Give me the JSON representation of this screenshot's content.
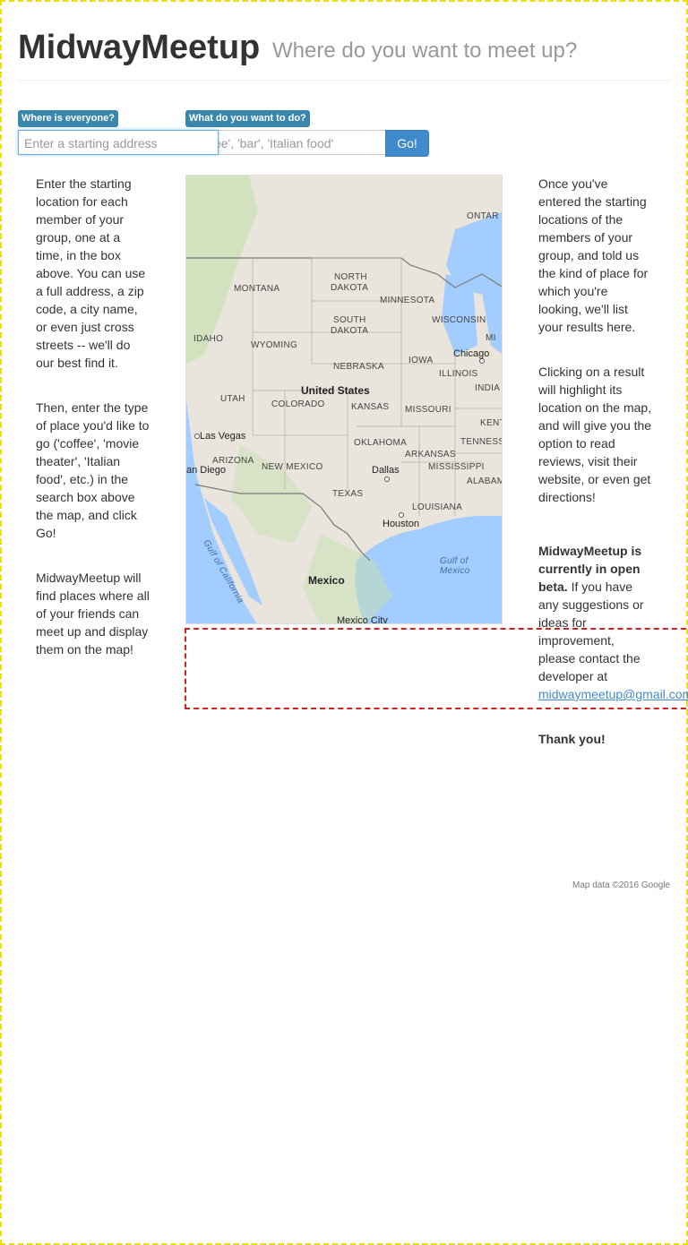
{
  "header": {
    "brand": "MidwayMeetup",
    "tagline": "Where do you want to meet up?"
  },
  "search": {
    "where_label": "Where is everyone?",
    "where_placeholder": "Enter a starting address",
    "what_label": "What do you want to do?",
    "what_placeholder": "'coffee', 'bar', 'Italian food'",
    "go_label": "Go!"
  },
  "instructions_left": [
    "Enter the starting location for each member of your group, one at a time, in the box above. You can use a full address, a zip code, a city name, or even just cross streets -- we'll do our best find it.",
    "Then, enter the type of place you'd like to go ('coffee', 'movie theater', 'Italian food', etc.) in the search box above the map, and click Go!",
    "MidwayMeetup will find places where all of your friends can meet up and display them on the map!"
  ],
  "instructions_right": {
    "p1": "Once you've entered the starting locations of the members of your group, and told us the kind of place for which you're looking, we'll list your results here.",
    "p2": "Clicking on a result will highlight its location on the map, and will give you the option to read reviews, visit their website, or even get directions!",
    "beta_bold": "MidwayMeetup is currently in open beta.",
    "beta_text": " If you have any suggestions or ideas for improvement, please contact the developer at ",
    "email": "midwaymeetup@gmail.com",
    "thanks": "Thank you!"
  },
  "map": {
    "labels": {
      "ontario": "ONTAR",
      "north_dakota_1": "NORTH",
      "north_dakota_2": "DAKOTA",
      "montana": "MONTANA",
      "minnesota": "MINNESOTA",
      "south_dakota_1": "SOUTH",
      "south_dakota_2": "DAKOTA",
      "wisconsin": "WISCONSIN",
      "idaho": "IDAHO",
      "wyoming": "WYOMING",
      "iowa": "IOWA",
      "mi": "MI",
      "nebraska": "NEBRASKA",
      "chicago": "Chicago",
      "illinois": "ILLINOIS",
      "united_states": "United States",
      "utah": "UTAH",
      "colorado": "COLORADO",
      "kansas": "KANSAS",
      "missouri": "MISSOURI",
      "india": "INDIA",
      "kent": "KENT",
      "las_vegas": "Las Vegas",
      "oklahoma": "OKLAHOMA",
      "tenness": "TENNESS",
      "arizona": "ARIZONA",
      "arkansas": "ARKANSAS",
      "san_diego": "an Diego",
      "new_mexico": "NEW MEXICO",
      "dallas": "Dallas",
      "mississippi": "MISSISSIPPI",
      "alabam": "ALABAM",
      "texas": "TEXAS",
      "louisiana": "LOUISIANA",
      "houston": "Houston",
      "gulf_california": "Gulf of California",
      "gulf_mexico_1": "Gulf of",
      "gulf_mexico_2": "Mexico",
      "mexico": "Mexico",
      "mexico_city": "Mexico City"
    },
    "colors": {
      "land": "#e9e5dc",
      "water": "#a3ccff",
      "park": "#c8dfb0",
      "border": "#7a7a7a"
    }
  },
  "footer": {
    "attribution": "Map data ©2016 Google"
  }
}
